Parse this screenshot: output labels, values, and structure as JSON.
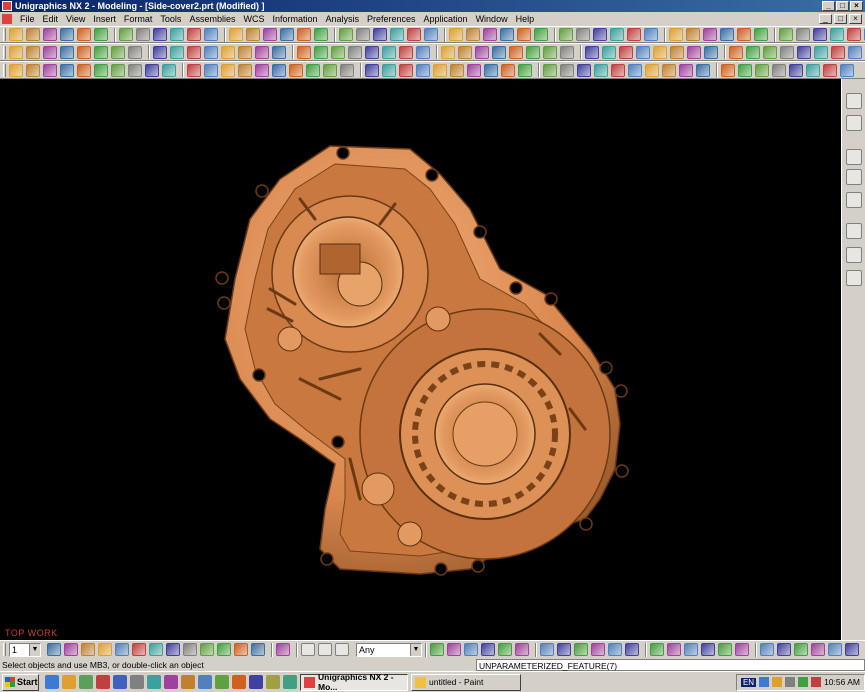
{
  "window": {
    "title": "Unigraphics NX 2 - Modeling - [Side-cover2.prt (Modified) ]",
    "minimize": "_",
    "maximize": "□",
    "close": "×"
  },
  "menu": [
    "File",
    "Edit",
    "View",
    "Insert",
    "Format",
    "Tools",
    "Assemblies",
    "WCS",
    "Information",
    "Analysis",
    "Preferences",
    "Application",
    "Window",
    "Help"
  ],
  "viewport": {
    "view_name": "TOP WORK",
    "background": "#000000",
    "part_color": "#d9874e"
  },
  "bottom_toolbar": {
    "layer_value": "1",
    "filter_value": "Any"
  },
  "status": {
    "prompt": "Select objects and use MB3, or double-click an object",
    "feature": "UNPARAMETERIZED_FEATURE(7)"
  },
  "taskbar": {
    "start": "Start",
    "tasks": [
      {
        "label": "Unigraphics NX 2 - Mo...",
        "active": true
      },
      {
        "label": "untitled - Paint",
        "active": false
      }
    ],
    "clock": "10:56 AM",
    "language": "EN"
  },
  "colors": {
    "titlebar": "#0a246a",
    "chrome": "#d4d0c8",
    "view_label": "#c8402a"
  }
}
